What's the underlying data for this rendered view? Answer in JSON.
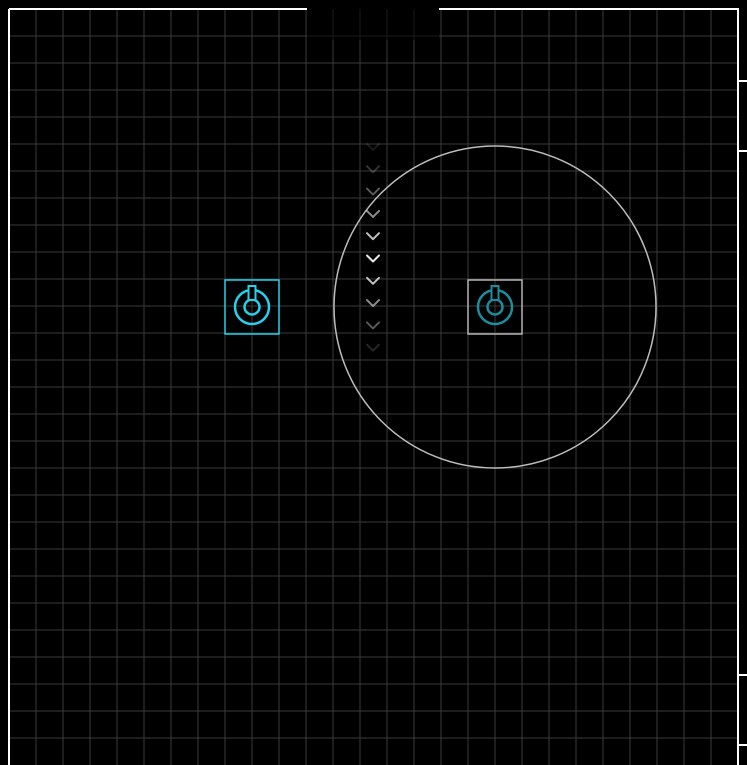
{
  "colors": {
    "background": "#000000",
    "grid_line": "#3a3a3a",
    "wall": "#ffffff",
    "player_accent": "#22d3ee",
    "target_accent": "#1a8e9c",
    "target_frame": "#b5b5b5",
    "range_ring": "#bdbdbd",
    "path_chevron": "#ffffff"
  },
  "board": {
    "theme": "dark grid",
    "grid_visible": true
  },
  "player_unit": {
    "icon": "turret-icon",
    "state": "selected"
  },
  "target_unit": {
    "icon": "turret-icon",
    "state": "in-range"
  },
  "range_ring": {
    "visible": true
  },
  "path": {
    "icon": "chevron-down-icon",
    "direction": "down",
    "opacity_levels": [
      0.1,
      0.2,
      0.35,
      0.55,
      0.75,
      0.9,
      0.75,
      0.55,
      0.35,
      0.15
    ]
  }
}
